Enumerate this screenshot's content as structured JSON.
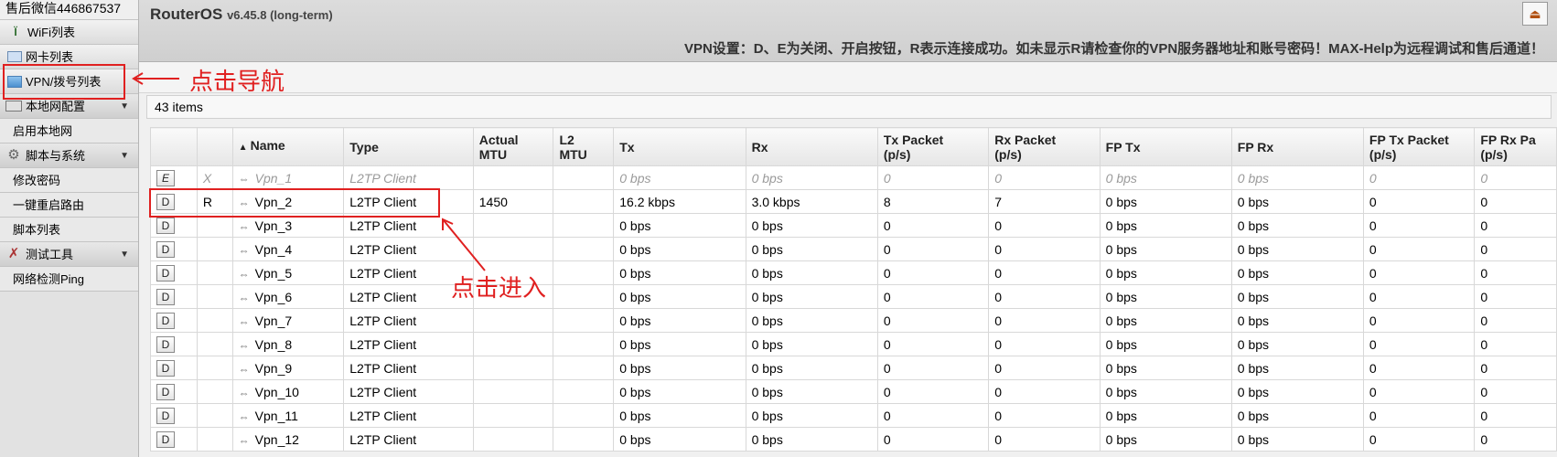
{
  "sidebar": {
    "contact": "售后微信446867537",
    "items": [
      {
        "label": "WiFi列表",
        "icon": "wifi-icon"
      },
      {
        "label": "网卡列表",
        "icon": "nic-icon"
      },
      {
        "label": "VPN/拨号列表",
        "icon": "vpn-icon"
      },
      {
        "label": "本地网配置",
        "icon": "lan-icon"
      },
      {
        "label": "启用本地网"
      },
      {
        "label": "脚本与系统",
        "icon": "gear-icon"
      },
      {
        "label": "修改密码"
      },
      {
        "label": "一键重启路由"
      },
      {
        "label": "脚本列表"
      },
      {
        "label": "测试工具",
        "icon": "tools-icon"
      },
      {
        "label": "网络检测Ping"
      }
    ]
  },
  "header": {
    "title": "RouterOS",
    "version": "v6.45.8 (long-term)",
    "notice": "VPN设置：D、E为关闭、开启按钮，R表示连接成功。如未显示R请检查你的VPN服务器地址和账号密码！MAX-Help为远程调试和售后通道！"
  },
  "list": {
    "count": "43 items",
    "columns": [
      "",
      "",
      "Name",
      "Type",
      "Actual MTU",
      "L2 MTU",
      "Tx",
      "Rx",
      "Tx Packet (p/s)",
      "Rx Packet (p/s)",
      "FP Tx",
      "FP Rx",
      "FP Tx Packet (p/s)",
      "FP Rx Packet (p/s)"
    ],
    "rows": [
      {
        "btn": "E",
        "flag": "X",
        "name": "Vpn_1",
        "type": "L2TP Client",
        "mtu": "",
        "l2mtu": "",
        "tx": "0 bps",
        "rx": "0 bps",
        "txp": "0",
        "rxp": "0",
        "fptx": "0 bps",
        "fprx": "0 bps",
        "fptxp": "0",
        "fprxp": "0",
        "disabled": true
      },
      {
        "btn": "D",
        "flag": "R",
        "name": "Vpn_2",
        "type": "L2TP Client",
        "mtu": "1450",
        "l2mtu": "",
        "tx": "16.2 kbps",
        "rx": "3.0 kbps",
        "txp": "8",
        "rxp": "7",
        "fptx": "0 bps",
        "fprx": "0 bps",
        "fptxp": "0",
        "fprxp": "0"
      },
      {
        "btn": "D",
        "flag": "",
        "name": "Vpn_3",
        "type": "L2TP Client",
        "mtu": "",
        "l2mtu": "",
        "tx": "0 bps",
        "rx": "0 bps",
        "txp": "0",
        "rxp": "0",
        "fptx": "0 bps",
        "fprx": "0 bps",
        "fptxp": "0",
        "fprxp": "0"
      },
      {
        "btn": "D",
        "flag": "",
        "name": "Vpn_4",
        "type": "L2TP Client",
        "mtu": "",
        "l2mtu": "",
        "tx": "0 bps",
        "rx": "0 bps",
        "txp": "0",
        "rxp": "0",
        "fptx": "0 bps",
        "fprx": "0 bps",
        "fptxp": "0",
        "fprxp": "0"
      },
      {
        "btn": "D",
        "flag": "",
        "name": "Vpn_5",
        "type": "L2TP Client",
        "mtu": "",
        "l2mtu": "",
        "tx": "0 bps",
        "rx": "0 bps",
        "txp": "0",
        "rxp": "0",
        "fptx": "0 bps",
        "fprx": "0 bps",
        "fptxp": "0",
        "fprxp": "0"
      },
      {
        "btn": "D",
        "flag": "",
        "name": "Vpn_6",
        "type": "L2TP Client",
        "mtu": "",
        "l2mtu": "",
        "tx": "0 bps",
        "rx": "0 bps",
        "txp": "0",
        "rxp": "0",
        "fptx": "0 bps",
        "fprx": "0 bps",
        "fptxp": "0",
        "fprxp": "0"
      },
      {
        "btn": "D",
        "flag": "",
        "name": "Vpn_7",
        "type": "L2TP Client",
        "mtu": "",
        "l2mtu": "",
        "tx": "0 bps",
        "rx": "0 bps",
        "txp": "0",
        "rxp": "0",
        "fptx": "0 bps",
        "fprx": "0 bps",
        "fptxp": "0",
        "fprxp": "0"
      },
      {
        "btn": "D",
        "flag": "",
        "name": "Vpn_8",
        "type": "L2TP Client",
        "mtu": "",
        "l2mtu": "",
        "tx": "0 bps",
        "rx": "0 bps",
        "txp": "0",
        "rxp": "0",
        "fptx": "0 bps",
        "fprx": "0 bps",
        "fptxp": "0",
        "fprxp": "0"
      },
      {
        "btn": "D",
        "flag": "",
        "name": "Vpn_9",
        "type": "L2TP Client",
        "mtu": "",
        "l2mtu": "",
        "tx": "0 bps",
        "rx": "0 bps",
        "txp": "0",
        "rxp": "0",
        "fptx": "0 bps",
        "fprx": "0 bps",
        "fptxp": "0",
        "fprxp": "0"
      },
      {
        "btn": "D",
        "flag": "",
        "name": "Vpn_10",
        "type": "L2TP Client",
        "mtu": "",
        "l2mtu": "",
        "tx": "0 bps",
        "rx": "0 bps",
        "txp": "0",
        "rxp": "0",
        "fptx": "0 bps",
        "fprx": "0 bps",
        "fptxp": "0",
        "fprxp": "0"
      },
      {
        "btn": "D",
        "flag": "",
        "name": "Vpn_11",
        "type": "L2TP Client",
        "mtu": "",
        "l2mtu": "",
        "tx": "0 bps",
        "rx": "0 bps",
        "txp": "0",
        "rxp": "0",
        "fptx": "0 bps",
        "fprx": "0 bps",
        "fptxp": "0",
        "fprxp": "0"
      },
      {
        "btn": "D",
        "flag": "",
        "name": "Vpn_12",
        "type": "L2TP Client",
        "mtu": "",
        "l2mtu": "",
        "tx": "0 bps",
        "rx": "0 bps",
        "txp": "0",
        "rxp": "0",
        "fptx": "0 bps",
        "fprx": "0 bps",
        "fptxp": "0",
        "fprxp": "0"
      }
    ]
  },
  "annotations": {
    "nav_hint": "点击导航",
    "row_hint": "点击进入",
    "color": "#e02020"
  }
}
